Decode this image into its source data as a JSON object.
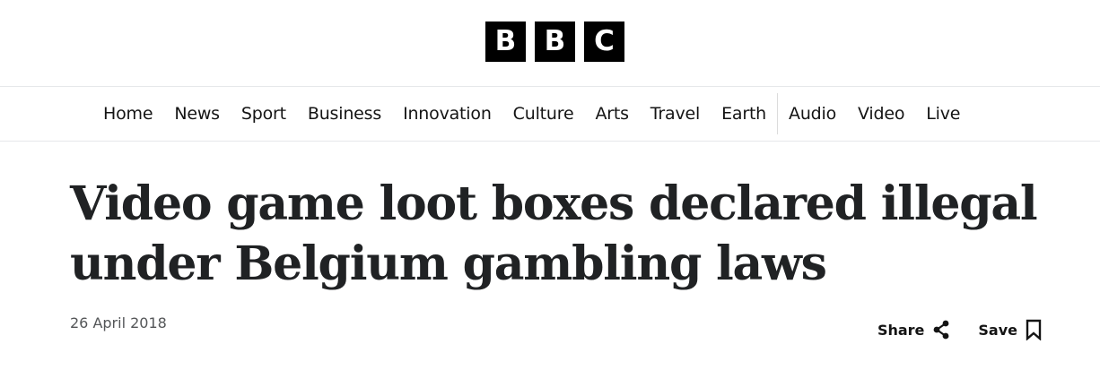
{
  "logo": {
    "letters": [
      "B",
      "B",
      "C"
    ]
  },
  "nav": {
    "primary": [
      "Home",
      "News",
      "Sport",
      "Business",
      "Innovation",
      "Culture",
      "Arts",
      "Travel",
      "Earth"
    ],
    "secondary": [
      "Audio",
      "Video",
      "Live"
    ]
  },
  "article": {
    "headline": "Video game loot boxes declared illegal under Belgium gambling laws",
    "date": "26 April 2018"
  },
  "actions": {
    "share_label": "Share",
    "share_icon": "share-icon",
    "save_label": "Save",
    "save_icon": "bookmark-icon"
  }
}
